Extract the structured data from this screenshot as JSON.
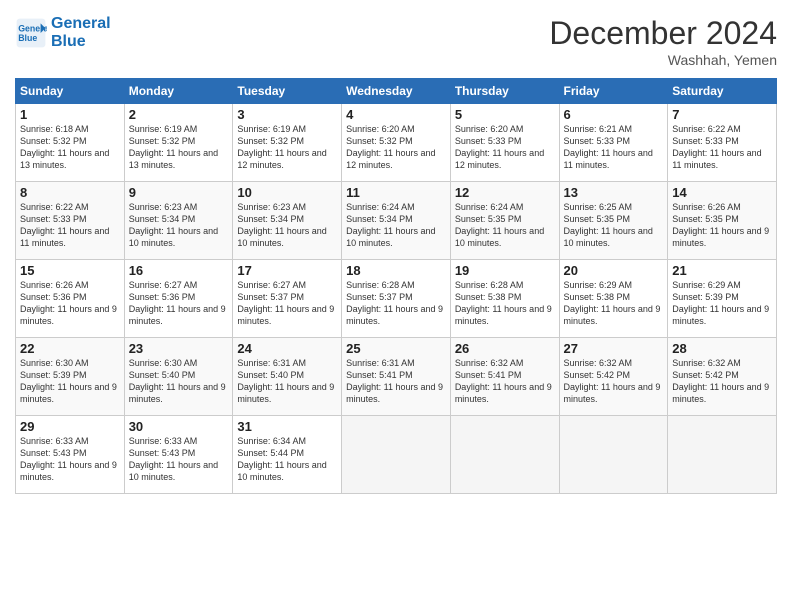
{
  "header": {
    "logo_line1": "General",
    "logo_line2": "Blue",
    "month": "December 2024",
    "location": "Washhah, Yemen"
  },
  "days_of_week": [
    "Sunday",
    "Monday",
    "Tuesday",
    "Wednesday",
    "Thursday",
    "Friday",
    "Saturday"
  ],
  "weeks": [
    [
      {
        "num": "1",
        "sunrise": "6:18 AM",
        "sunset": "5:32 PM",
        "daylight": "11 hours and 13 minutes."
      },
      {
        "num": "2",
        "sunrise": "6:19 AM",
        "sunset": "5:32 PM",
        "daylight": "11 hours and 13 minutes."
      },
      {
        "num": "3",
        "sunrise": "6:19 AM",
        "sunset": "5:32 PM",
        "daylight": "11 hours and 12 minutes."
      },
      {
        "num": "4",
        "sunrise": "6:20 AM",
        "sunset": "5:32 PM",
        "daylight": "11 hours and 12 minutes."
      },
      {
        "num": "5",
        "sunrise": "6:20 AM",
        "sunset": "5:33 PM",
        "daylight": "11 hours and 12 minutes."
      },
      {
        "num": "6",
        "sunrise": "6:21 AM",
        "sunset": "5:33 PM",
        "daylight": "11 hours and 11 minutes."
      },
      {
        "num": "7",
        "sunrise": "6:22 AM",
        "sunset": "5:33 PM",
        "daylight": "11 hours and 11 minutes."
      }
    ],
    [
      {
        "num": "8",
        "sunrise": "6:22 AM",
        "sunset": "5:33 PM",
        "daylight": "11 hours and 11 minutes."
      },
      {
        "num": "9",
        "sunrise": "6:23 AM",
        "sunset": "5:34 PM",
        "daylight": "11 hours and 10 minutes."
      },
      {
        "num": "10",
        "sunrise": "6:23 AM",
        "sunset": "5:34 PM",
        "daylight": "11 hours and 10 minutes."
      },
      {
        "num": "11",
        "sunrise": "6:24 AM",
        "sunset": "5:34 PM",
        "daylight": "11 hours and 10 minutes."
      },
      {
        "num": "12",
        "sunrise": "6:24 AM",
        "sunset": "5:35 PM",
        "daylight": "11 hours and 10 minutes."
      },
      {
        "num": "13",
        "sunrise": "6:25 AM",
        "sunset": "5:35 PM",
        "daylight": "11 hours and 10 minutes."
      },
      {
        "num": "14",
        "sunrise": "6:26 AM",
        "sunset": "5:35 PM",
        "daylight": "11 hours and 9 minutes."
      }
    ],
    [
      {
        "num": "15",
        "sunrise": "6:26 AM",
        "sunset": "5:36 PM",
        "daylight": "11 hours and 9 minutes."
      },
      {
        "num": "16",
        "sunrise": "6:27 AM",
        "sunset": "5:36 PM",
        "daylight": "11 hours and 9 minutes."
      },
      {
        "num": "17",
        "sunrise": "6:27 AM",
        "sunset": "5:37 PM",
        "daylight": "11 hours and 9 minutes."
      },
      {
        "num": "18",
        "sunrise": "6:28 AM",
        "sunset": "5:37 PM",
        "daylight": "11 hours and 9 minutes."
      },
      {
        "num": "19",
        "sunrise": "6:28 AM",
        "sunset": "5:38 PM",
        "daylight": "11 hours and 9 minutes."
      },
      {
        "num": "20",
        "sunrise": "6:29 AM",
        "sunset": "5:38 PM",
        "daylight": "11 hours and 9 minutes."
      },
      {
        "num": "21",
        "sunrise": "6:29 AM",
        "sunset": "5:39 PM",
        "daylight": "11 hours and 9 minutes."
      }
    ],
    [
      {
        "num": "22",
        "sunrise": "6:30 AM",
        "sunset": "5:39 PM",
        "daylight": "11 hours and 9 minutes."
      },
      {
        "num": "23",
        "sunrise": "6:30 AM",
        "sunset": "5:40 PM",
        "daylight": "11 hours and 9 minutes."
      },
      {
        "num": "24",
        "sunrise": "6:31 AM",
        "sunset": "5:40 PM",
        "daylight": "11 hours and 9 minutes."
      },
      {
        "num": "25",
        "sunrise": "6:31 AM",
        "sunset": "5:41 PM",
        "daylight": "11 hours and 9 minutes."
      },
      {
        "num": "26",
        "sunrise": "6:32 AM",
        "sunset": "5:41 PM",
        "daylight": "11 hours and 9 minutes."
      },
      {
        "num": "27",
        "sunrise": "6:32 AM",
        "sunset": "5:42 PM",
        "daylight": "11 hours and 9 minutes."
      },
      {
        "num": "28",
        "sunrise": "6:32 AM",
        "sunset": "5:42 PM",
        "daylight": "11 hours and 9 minutes."
      }
    ],
    [
      {
        "num": "29",
        "sunrise": "6:33 AM",
        "sunset": "5:43 PM",
        "daylight": "11 hours and 9 minutes."
      },
      {
        "num": "30",
        "sunrise": "6:33 AM",
        "sunset": "5:43 PM",
        "daylight": "11 hours and 10 minutes."
      },
      {
        "num": "31",
        "sunrise": "6:34 AM",
        "sunset": "5:44 PM",
        "daylight": "11 hours and 10 minutes."
      },
      null,
      null,
      null,
      null
    ]
  ]
}
